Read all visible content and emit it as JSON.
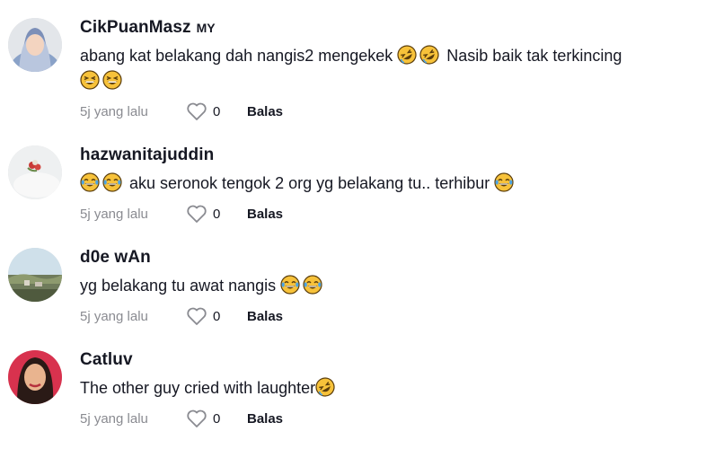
{
  "comments": [
    {
      "username": "CikPuanMasz",
      "country": "MY",
      "text_parts": [
        "abang kat belakang dah nangis2 mengekek ",
        "rofl",
        "rofl",
        " Nasib baik tak terkincing",
        "br",
        "grin",
        "grin"
      ],
      "time": "5j yang lalu",
      "likes": "0",
      "reply": "Balas"
    },
    {
      "username": "hazwanitajuddin",
      "country": "",
      "text_parts": [
        "joy",
        "joy",
        " aku seronok tengok 2 org yg belakang tu.. terhibur ",
        "joy"
      ],
      "time": "5j yang lalu",
      "likes": "0",
      "reply": "Balas"
    },
    {
      "username": "d0e wAn",
      "country": "",
      "text_parts": [
        "yg belakang tu awat nangis ",
        "joy",
        "joy"
      ],
      "time": "5j yang lalu",
      "likes": "0",
      "reply": "Balas"
    },
    {
      "username": "Catluv",
      "country": "",
      "text_parts": [
        "The other guy cried with laughter",
        "rofl"
      ],
      "time": "5j yang lalu",
      "likes": "0",
      "reply": "Balas"
    }
  ],
  "icons": {
    "like": "heart-outline-icon",
    "emoji_rofl": "rofl-emoji-icon",
    "emoji_joy": "joy-emoji-icon",
    "emoji_grin": "grinning-squint-emoji-icon"
  },
  "colors": {
    "text": "#161823",
    "muted": "#8a8b91",
    "emoji_yellow": "#f7c23a",
    "emoji_outline": "#5a3d0c"
  }
}
